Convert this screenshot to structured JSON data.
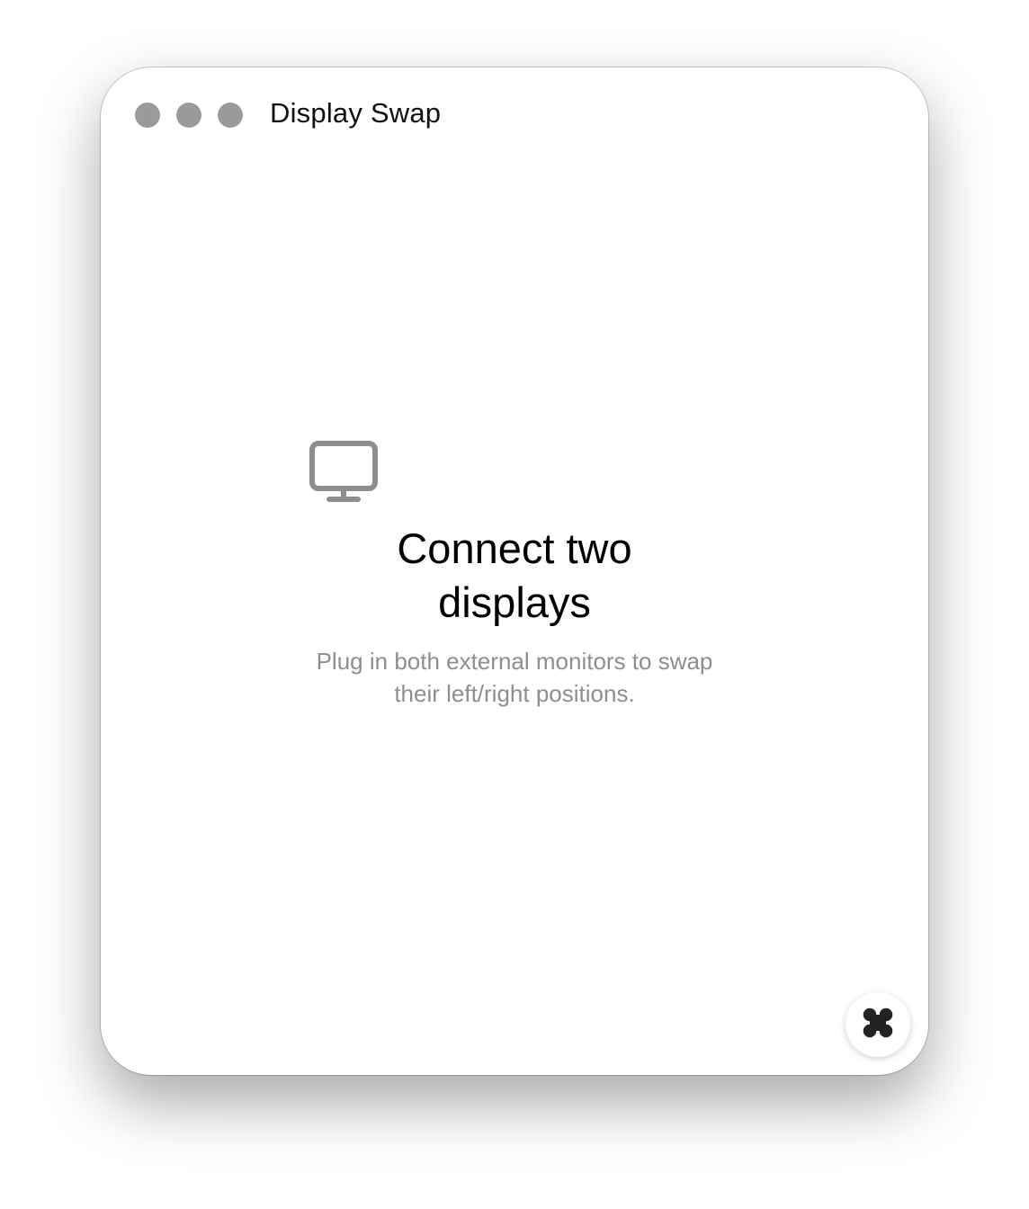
{
  "window": {
    "title": "Display Swap",
    "traffic_lights": [
      "close",
      "minimize",
      "zoom"
    ]
  },
  "empty_state": {
    "icon": "monitor-icon",
    "title": "Connect two displays",
    "subtitle": "Plug in both external monitors to swap their left/right positions."
  },
  "fab": {
    "icon": "command-icon"
  },
  "colors": {
    "traffic_light": "#9a9a9a",
    "icon_gray": "#8e8e8e",
    "subtitle_gray": "#8e8e8e",
    "fab_icon": "#222222"
  }
}
